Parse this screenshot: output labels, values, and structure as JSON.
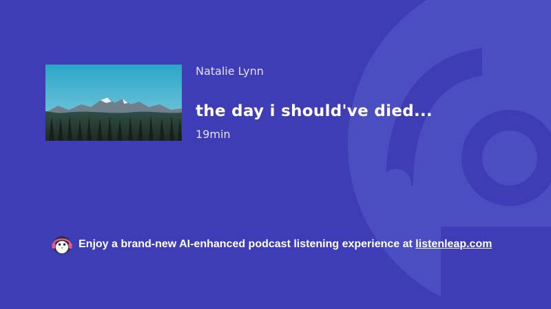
{
  "episode": {
    "author": "Natalie Lynn",
    "title": "the day i should've died...",
    "duration": "19min"
  },
  "icons": {
    "background": "listenleap-logo-watermark",
    "thumbnail": "mountain-forest-landscape",
    "mascot": "penguin-headphones-icon"
  },
  "promo": {
    "text": "Enjoy a brand-new AI-enhanced podcast listening experience at ",
    "link": "listenleap.com"
  },
  "colors": {
    "background": "#3f3db6",
    "watermark": "#4b4ec0",
    "text": "#ffffff",
    "muted_text": "#e2e2f6"
  }
}
